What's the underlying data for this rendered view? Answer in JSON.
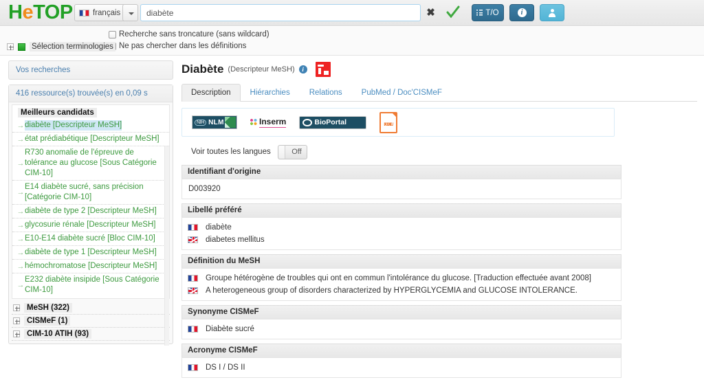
{
  "app": {
    "logo_he": "H",
    "logo_e": "e",
    "logo_top": "TOP"
  },
  "header": {
    "language_label": "français",
    "language_flag": "flag-fr-icon",
    "caret_icon": "chevron-down-icon",
    "search_value": "diabète",
    "search_placeholder": "",
    "clear_icon": "close-x-icon",
    "validate_icon": "green-check-icon",
    "to_button_label": "T/O",
    "to_button_icon": "list-icon",
    "info_button_icon": "info-icon",
    "user_button_icon": "user-icon"
  },
  "options": {
    "checkbox_no_wildcard": "Recherche sans troncature (sans wildcard)",
    "checkbox_no_definitions": "Ne pas chercher dans les définitions",
    "terminology_selection": "Sélection terminologies",
    "expand_icon": "plus-box-icon",
    "terminology_icon": "green-square-icon"
  },
  "sidebar": {
    "saved_searches": "Vos recherches",
    "results_count": "416 ressource(s) trouvée(s) en 0,09 s",
    "candidates_header": "Meilleurs candidats",
    "candidates": [
      {
        "label": "diabète [Descripteur MeSH]",
        "selected": true
      },
      {
        "label": "état prédiabétique [Descripteur MeSH]",
        "selected": false
      },
      {
        "label": "R730 anomalie de l'épreuve de tolérance au glucose [Sous Catégorie CIM-10]",
        "selected": false
      },
      {
        "label": "E14 diabète sucré, sans précision [Catégorie CIM-10]",
        "selected": false
      },
      {
        "label": "diabète de type 2 [Descripteur MeSH]",
        "selected": false
      },
      {
        "label": "glycosurie rénale [Descripteur MeSH]",
        "selected": false
      },
      {
        "label": "E10-E14 diabète sucré [Bloc CIM-10]",
        "selected": false
      },
      {
        "label": "diabète de type 1 [Descripteur MeSH]",
        "selected": false
      },
      {
        "label": "hémochromatose [Descripteur MeSH]",
        "selected": false
      },
      {
        "label": "E232 diabète insipide [Sous Catégorie CIM-10]",
        "selected": false
      }
    ],
    "trees": [
      {
        "label": "MeSH (322)"
      },
      {
        "label": "CISMeF (1)"
      },
      {
        "label": "CIM-10 ATIH (93)"
      }
    ]
  },
  "main": {
    "title": "Diabète",
    "subtitle": "(Descripteur MeSH)",
    "info_icon": "info-icon",
    "export_icon": "red-export-icon",
    "tabs": [
      {
        "label": "Description",
        "active": true
      },
      {
        "label": "Hiérarchies",
        "active": false
      },
      {
        "label": "Relations",
        "active": false
      },
      {
        "label": "PubMed / Doc'CISMeF",
        "active": false
      }
    ],
    "external_logos": [
      {
        "name": "nlm-logo",
        "nih": "NIH",
        "nlm": "NLM"
      },
      {
        "name": "inserm-logo",
        "text": "Inserm"
      },
      {
        "name": "bioportal-logo",
        "text": "BioPortal"
      },
      {
        "name": "rdf-xml-logo",
        "line1": "RDF/",
        "line2": "XML"
      }
    ],
    "all_languages_label": "Voir toutes les langues",
    "all_languages_state": "Off",
    "sections": [
      {
        "heading": "Identifiant d'origine",
        "rows": [
          {
            "flag": "",
            "text": "D003920"
          }
        ]
      },
      {
        "heading": "Libellé préféré",
        "rows": [
          {
            "flag": "fr",
            "text": "diabète"
          },
          {
            "flag": "gb",
            "text": "diabetes mellitus"
          }
        ]
      },
      {
        "heading": "Définition du MeSH",
        "rows": [
          {
            "flag": "fr",
            "text": "Groupe hétérogène de troubles qui ont en commun l'intolérance du glucose. [Traduction effectuée avant 2008]"
          },
          {
            "flag": "gb",
            "text": "A heterogeneous group of disorders characterized by HYPERGLYCEMIA and GLUCOSE INTOLERANCE."
          }
        ]
      },
      {
        "heading": "Synonyme CISMeF",
        "rows": [
          {
            "flag": "fr",
            "text": "Diabète sucré"
          }
        ]
      },
      {
        "heading": "Acronyme CISMeF",
        "rows": [
          {
            "flag": "fr",
            "text": "DS I / DS II"
          }
        ]
      }
    ]
  },
  "colors": {
    "logo_green": "#22a026",
    "logo_orange": "#f08c1c",
    "link_green": "#3d9a3f",
    "link_blue": "#4a7fae",
    "accent_blue": "#2e6a8e",
    "user_blue": "#52b4d6",
    "selection_blue": "#cfe7f5",
    "export_red": "#ee2222",
    "rdf_orange": "#ef7b33"
  }
}
